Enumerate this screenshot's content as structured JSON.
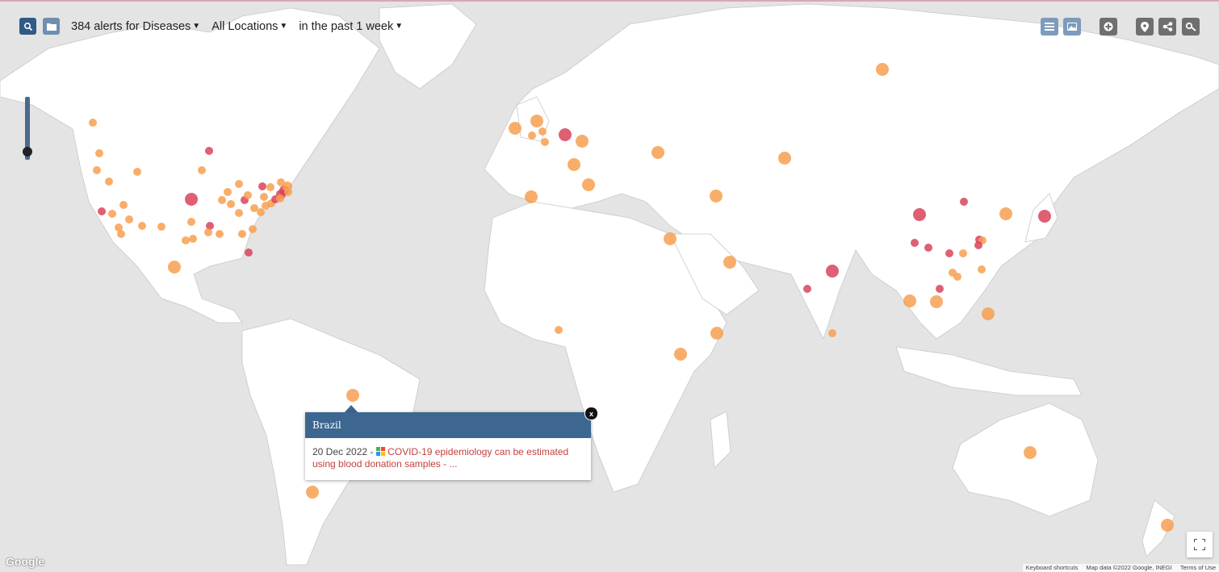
{
  "topbar": {
    "count_text": "384 alerts for Diseases",
    "location_text": "All Locations",
    "time_text": "in the past 1 week",
    "search_icon": "search-icon",
    "folder_icon": "folder-icon"
  },
  "toolbar_right": {
    "icons": [
      "list-icon",
      "image-icon",
      "add-icon",
      "location-pin-icon",
      "share-icon",
      "key-icon"
    ]
  },
  "popup": {
    "title": "Brazil",
    "date": "20 Dec 2022 -",
    "link_text_1": "COVID-19 epidemiology can be estimated",
    "link_text_2": "using blood donation samples - ...",
    "close_label": "x"
  },
  "map": {
    "attribution_logo": "Google",
    "footer_shortcuts": "Keyboard shortcuts",
    "footer_data": "Map data ©2022 Google, INEGI",
    "footer_terms": "Terms of Use"
  },
  "colors": {
    "map_water": "#e4e4e4",
    "land": "#ffffff",
    "marker_orange": "#f7a050",
    "marker_red": "#d9435a",
    "header_blue": "#3d6790",
    "link_red": "#c4403e"
  }
}
